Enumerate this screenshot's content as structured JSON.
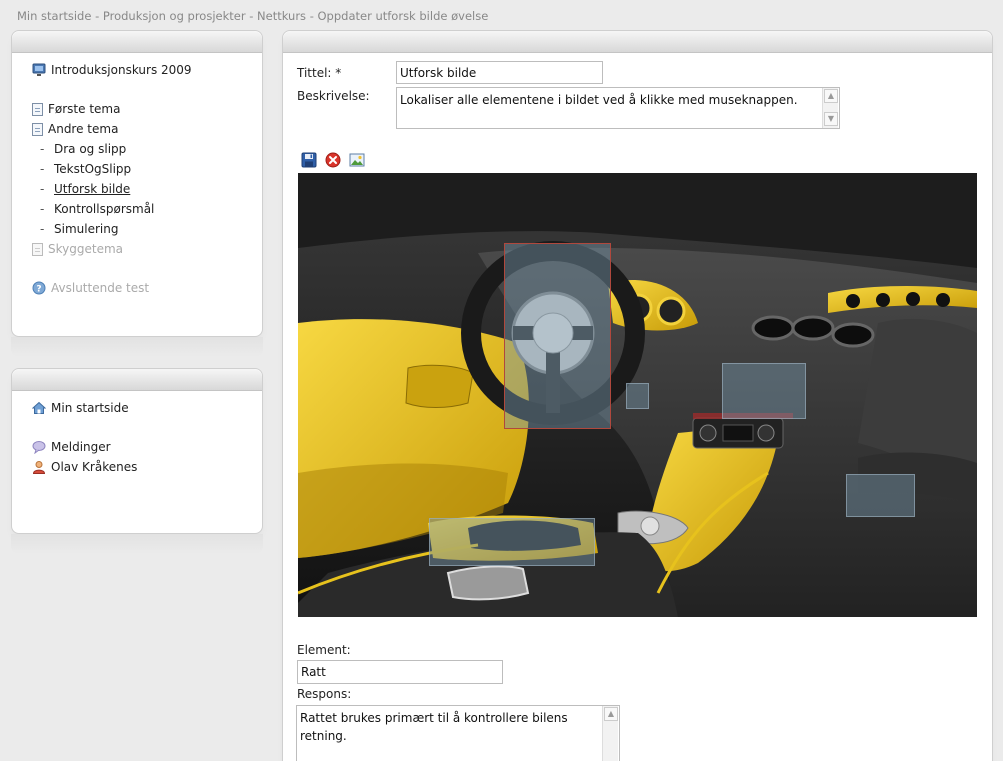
{
  "breadcrumb": "Min startside - Produksjon og prosjekter - Nettkurs - Oppdater utforsk bilde øvelse",
  "course_nav": {
    "course_title": "Introduksjonskurs 2009",
    "items": [
      {
        "label": "Første tema",
        "icon": "document-icon"
      },
      {
        "label": "Andre tema",
        "icon": "document-icon"
      },
      {
        "label": "Dra og slipp",
        "prefix": "-"
      },
      {
        "label": "TekstOgSlipp",
        "prefix": "-"
      },
      {
        "label": "Utforsk bilde",
        "prefix": "-"
      },
      {
        "label": "Kontrollspørsmål",
        "prefix": "-"
      },
      {
        "label": "Simulering",
        "prefix": "-"
      },
      {
        "label": "Skyggetema",
        "icon": "document-icon"
      }
    ],
    "final_test": "Avsluttende test"
  },
  "user_nav": {
    "home": "Min startside",
    "messages": "Meldinger",
    "user": "Olav Kråkenes"
  },
  "form": {
    "title_label": "Tittel: *",
    "title_value": "Utforsk bilde",
    "description_label": "Beskrivelse:",
    "description_value": "Lokaliser alle elementene i bildet ved å klikke med museknappen.",
    "element_label": "Element:",
    "element_value": "Ratt",
    "response_label": "Respons:",
    "response_value": "Rattet brukes primært til å kontrollere bilens retning."
  },
  "toolbar": {
    "save_icon": "save-icon",
    "delete_icon": "delete-icon",
    "image_icon": "image-icon"
  },
  "colors": {
    "accent_yellow": "#e6c21c",
    "hotspot_fill": "#7896aa",
    "selected_border": "#b0483d"
  }
}
